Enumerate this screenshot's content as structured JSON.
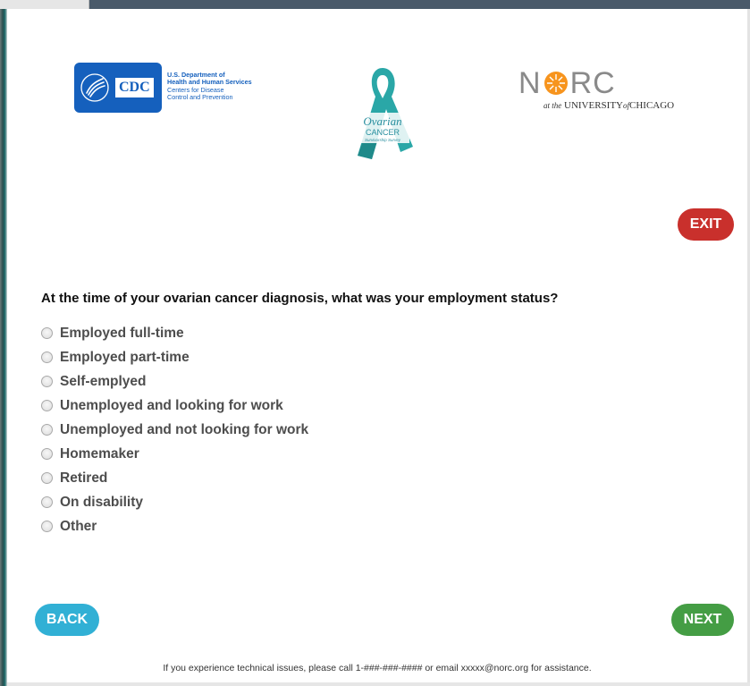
{
  "logos": {
    "cdc_mark": "CDC",
    "cdc_lines": [
      "U.S. Department of",
      "Health and Human Services",
      "Centers for Disease",
      "Control and Prevention"
    ],
    "ribbon_lines": [
      "Ovarian",
      "CANCER",
      "Survivorship Survey"
    ],
    "norc_word_left": "N",
    "norc_word_right": "RC",
    "norc_sub_prefix": "at the",
    "norc_sub_main": "UNIVERSITY",
    "norc_sub_of": "of",
    "norc_sub_end": "CHICAGO"
  },
  "buttons": {
    "exit": "EXIT",
    "back": "BACK",
    "next": "NEXT"
  },
  "question": "At the time of your ovarian cancer diagnosis, what was your employment status?",
  "options": [
    "Employed full-time",
    "Employed part-time",
    "Self-emplyed",
    "Unemployed and looking for work",
    "Unemployed and not looking for work",
    "Homemaker",
    "Retired",
    "On disability",
    "Other"
  ],
  "footer": "If you experience technical issues, please call 1-###-###-#### or email xxxxx@norc.org for assistance.",
  "colors": {
    "exit": "#c9302c",
    "back": "#31b0d5",
    "next": "#449d44",
    "cdc_blue": "#1560bd",
    "ribbon_teal": "#2aa7a7",
    "norc_orange": "#f7941d"
  }
}
